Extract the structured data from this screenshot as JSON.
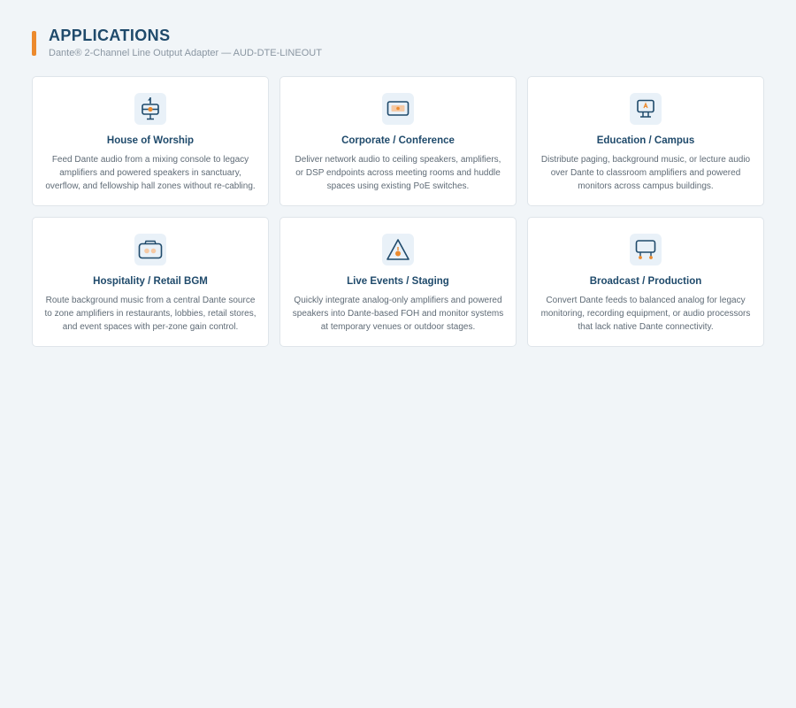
{
  "header": {
    "title": "APPLICATIONS",
    "subtitle": "Dante® 2-Channel Line Output Adapter — AUD-DTE-LINEOUT"
  },
  "colors": {
    "accent": "#ec8a2d",
    "title": "#1f4a6b",
    "icon_tile": "#e9f1f8"
  },
  "cards": [
    {
      "icon": "church-icon",
      "title": "House of Worship",
      "description": "Feed Dante audio from a mixing console to legacy amplifiers and powered speakers in sanctuary, overflow, and fellowship hall zones without re-cabling."
    },
    {
      "icon": "conference-display-icon",
      "title": "Corporate / Conference",
      "description": "Deliver network audio to ceiling speakers, amplifiers, or DSP endpoints across meeting rooms and huddle spaces using existing PoE switches."
    },
    {
      "icon": "classroom-screen-icon",
      "title": "Education / Campus",
      "description": "Distribute paging, background music, or lecture audio over Dante to classroom amplifiers and powered monitors across campus buildings."
    },
    {
      "icon": "radio-speaker-icon",
      "title": "Hospitality / Retail BGM",
      "description": "Route background music from a central Dante source to zone amplifiers in restaurants, lobbies, retail stores, and event spaces with per-zone gain control."
    },
    {
      "icon": "stage-tent-icon",
      "title": "Live Events / Staging",
      "description": "Quickly integrate analog-only amplifiers and powered speakers into Dante-based FOH and monitor systems at temporary venues or outdoor stages."
    },
    {
      "icon": "broadcast-monitor-icon",
      "title": "Broadcast / Production",
      "description": "Convert Dante feeds to balanced analog for legacy monitoring, recording equipment, or audio processors that lack native Dante connectivity."
    }
  ]
}
